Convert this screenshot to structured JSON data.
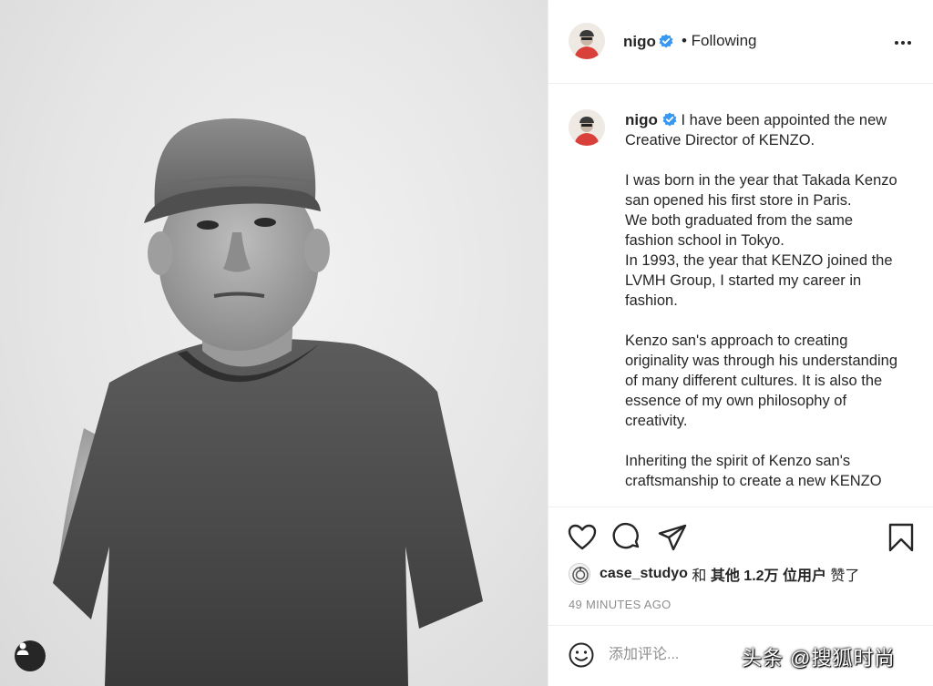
{
  "post": {
    "username": "nigo",
    "follow_status": "• Following",
    "caption_text": "I have been appointed the new Creative Director of KENZO.\n\nI was born in the year that Takada Kenzo san opened his first store in Paris.\nWe both graduated from the same fashion school in Tokyo.\nIn 1993, the year that KENZO joined the LVMH Group, I started my career in fashion.\n\nKenzo san's approach to creating originality was through his understanding of many different cultures. It is also the essence of my own philosophy of creativity.\n\nInheriting the spirit of Kenzo san's craftsmanship to create a new KENZO",
    "likes": {
      "liker": "case_studyo",
      "connector": " 和 ",
      "others": "其他 1.2万 位用户",
      "suffix": " 赞了"
    },
    "timestamp": "49 MINUTES AGO",
    "comment_placeholder": "添加评论...",
    "watermark": "头条 @搜狐时尚"
  },
  "icons": {
    "verified": "verified-badge-icon",
    "more": "more-options-icon",
    "like": "heart-icon",
    "comment": "comment-bubble-icon",
    "share": "paper-plane-icon",
    "save": "bookmark-icon",
    "emoji": "emoji-smiley-icon",
    "user_tag": "user-tag-icon"
  },
  "colors": {
    "verified_blue": "#3897f0",
    "avatar_red": "#d9403a",
    "text": "#262626",
    "muted": "#8e8e8e",
    "divider": "#efefef"
  }
}
